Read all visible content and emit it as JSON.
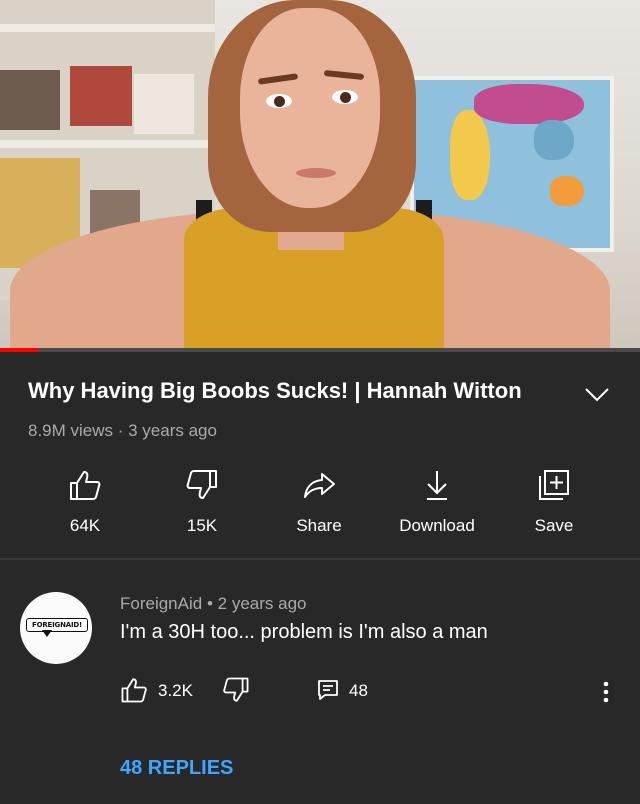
{
  "video": {
    "title": "Why Having Big Boobs Sucks! | Hannah Witton",
    "meta": "8.9M views · 3 years ago",
    "progress_fraction": 0.06
  },
  "actions": [
    {
      "label": "64K",
      "icon": "thumb-up-icon"
    },
    {
      "label": "15K",
      "icon": "thumb-down-icon"
    },
    {
      "label": "Share",
      "icon": "share-icon"
    },
    {
      "label": "Download",
      "icon": "download-icon"
    },
    {
      "label": "Save",
      "icon": "playlist-add-icon"
    }
  ],
  "comment": {
    "avatar_text": "FOREIGNAID!",
    "author": "ForeignAid",
    "time": "2 years ago",
    "text": "I'm a 30H too... problem is I'm also a man",
    "likes": "3.2K",
    "replies_count": "48",
    "replies_label": "48 REPLIES"
  },
  "colors": {
    "background": "#282828",
    "accent_link": "#3ea6ff",
    "progress": "#ff0000",
    "secondary_text": "#aaaaaa"
  }
}
